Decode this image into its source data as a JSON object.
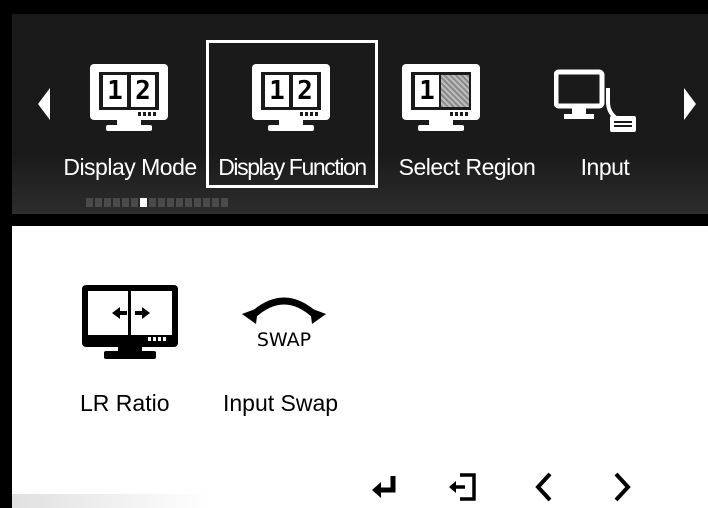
{
  "menu": {
    "items": [
      {
        "label": "Display Mode",
        "icon": "monitor-split-12-icon",
        "digits": [
          "1",
          "2"
        ]
      },
      {
        "label": "Display Function",
        "icon": "monitor-split-12-icon",
        "digits": [
          "1",
          "2"
        ],
        "selected": true
      },
      {
        "label": "Select Region",
        "icon": "monitor-region-1-icon",
        "digits": [
          "1"
        ]
      },
      {
        "label": "Input",
        "icon": "monitor-input-connector-icon"
      }
    ],
    "page_indicator": {
      "total": 16,
      "active_index": 5
    }
  },
  "submenu": {
    "items": [
      {
        "label": "LR Ratio",
        "icon": "lr-ratio-monitor-icon"
      },
      {
        "label": "Input Swap",
        "icon": "swap-arrow-icon",
        "icon_text": "SWAP"
      }
    ]
  },
  "controls": {
    "buttons": [
      "enter-icon",
      "exit-icon",
      "left-chevron-icon",
      "right-chevron-icon"
    ]
  },
  "colors": {
    "osd_background": "#1a1a1a",
    "text_light": "#ffffff",
    "text_dark": "#000000"
  }
}
